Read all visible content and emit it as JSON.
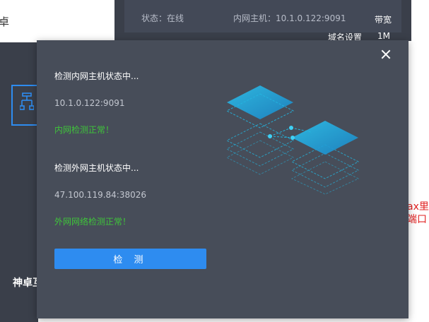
{
  "background": {
    "left_fragment": "卓",
    "left_bottom_label": "神卓互",
    "status_text": "状态：在线",
    "host_text": "内网主机：10.1.0.122:9091",
    "bandwidth_label": "带宽",
    "domain_setting_label": "域名设置",
    "bandwidth_value": "1M",
    "right_red_line1": "ax里",
    "right_red_line2": "端口"
  },
  "modal": {
    "internal": {
      "title": "检测内网主机状态中...",
      "address": "10.1.0.122:9091",
      "result": "内网检测正常！"
    },
    "external": {
      "title": "检测外网主机状态中...",
      "address": "47.100.119.84:38026",
      "result": "外网网络检测正常！"
    },
    "detect_button_label": "检 测"
  },
  "colors": {
    "modal_bg": "#474d59",
    "panel_bg": "#3a3f4a",
    "accent_blue": "#2e8cf0",
    "success_green": "#3fc43a",
    "illustration_cyan": "#23b6e0",
    "alert_red": "#e02020"
  },
  "icons": {
    "close": "close-icon",
    "network": "network-layers-icon",
    "sidebar": "network-topology-icon"
  }
}
